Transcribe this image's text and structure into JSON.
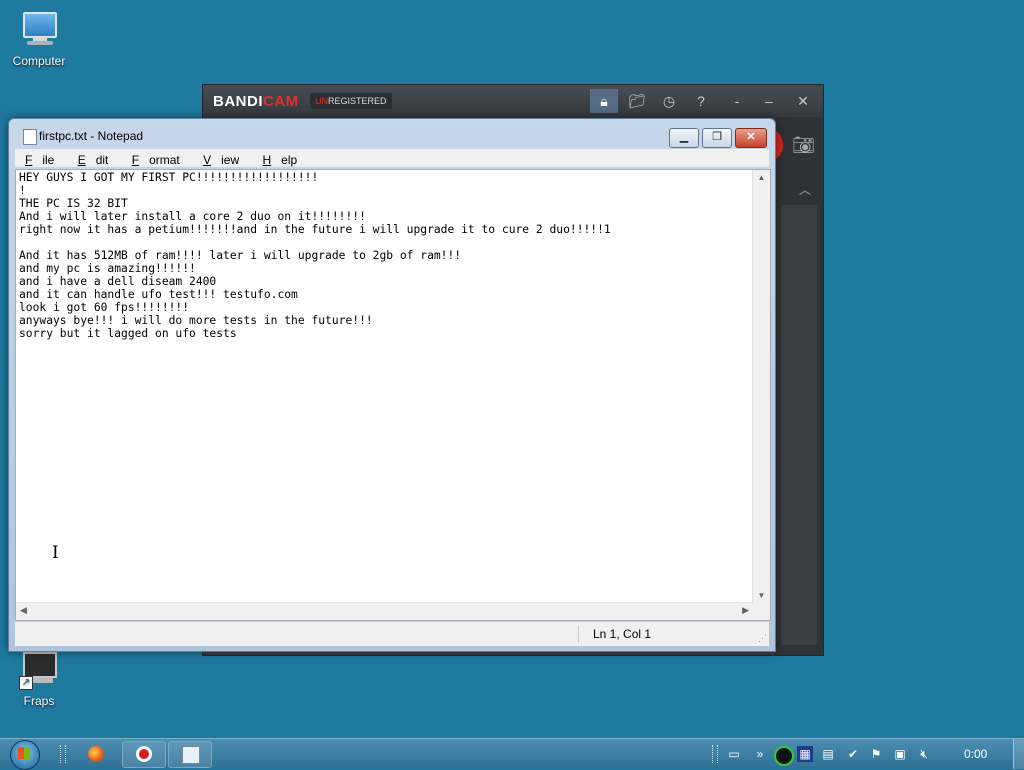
{
  "desktop": {
    "icons": [
      {
        "label": "Computer"
      },
      {
        "label": "Fraps"
      }
    ]
  },
  "bandicam": {
    "logo_main": "BANDI",
    "logo_accent": "CAM",
    "unreg_prefix": "UN",
    "unreg_rest": "REGISTERED",
    "accent_color": "#e0312b"
  },
  "notepad": {
    "title": "firstpc.txt - Notepad",
    "menu": [
      {
        "accel": "F",
        "rest": "ile"
      },
      {
        "accel": "E",
        "rest": "dit"
      },
      {
        "accel": "F",
        "rest": "ormat"
      },
      {
        "accel": "V",
        "rest": "iew"
      },
      {
        "accel": "H",
        "rest": "elp"
      }
    ],
    "content": "HEY GUYS I GOT MY FIRST PC!!!!!!!!!!!!!!!!!!\n!\nTHE PC IS 32 BIT\nAnd i will later install a core 2 duo on it!!!!!!!!\nright now it has a petium!!!!!!!and in the future i will upgrade it to cure 2 duo!!!!!1\n\nAnd it has 512MB of ram!!!! later i will upgrade to 2gb of ram!!!\nand my pc is amazing!!!!!!\nand i have a dell diseam 2400\nand it can handle ufo test!!! testufo.com\nlook i got 60 fps!!!!!!!!\nanyways bye!!! i will do more tests in the future!!!\nsorry but it lagged on ufo tests",
    "status_position": "Ln 1, Col 1"
  },
  "taskbar": {
    "clock": "0:00",
    "pinned": [
      {
        "name": "firefox-icon"
      },
      {
        "name": "bandicam-icon"
      },
      {
        "name": "notepad-icon"
      }
    ]
  }
}
